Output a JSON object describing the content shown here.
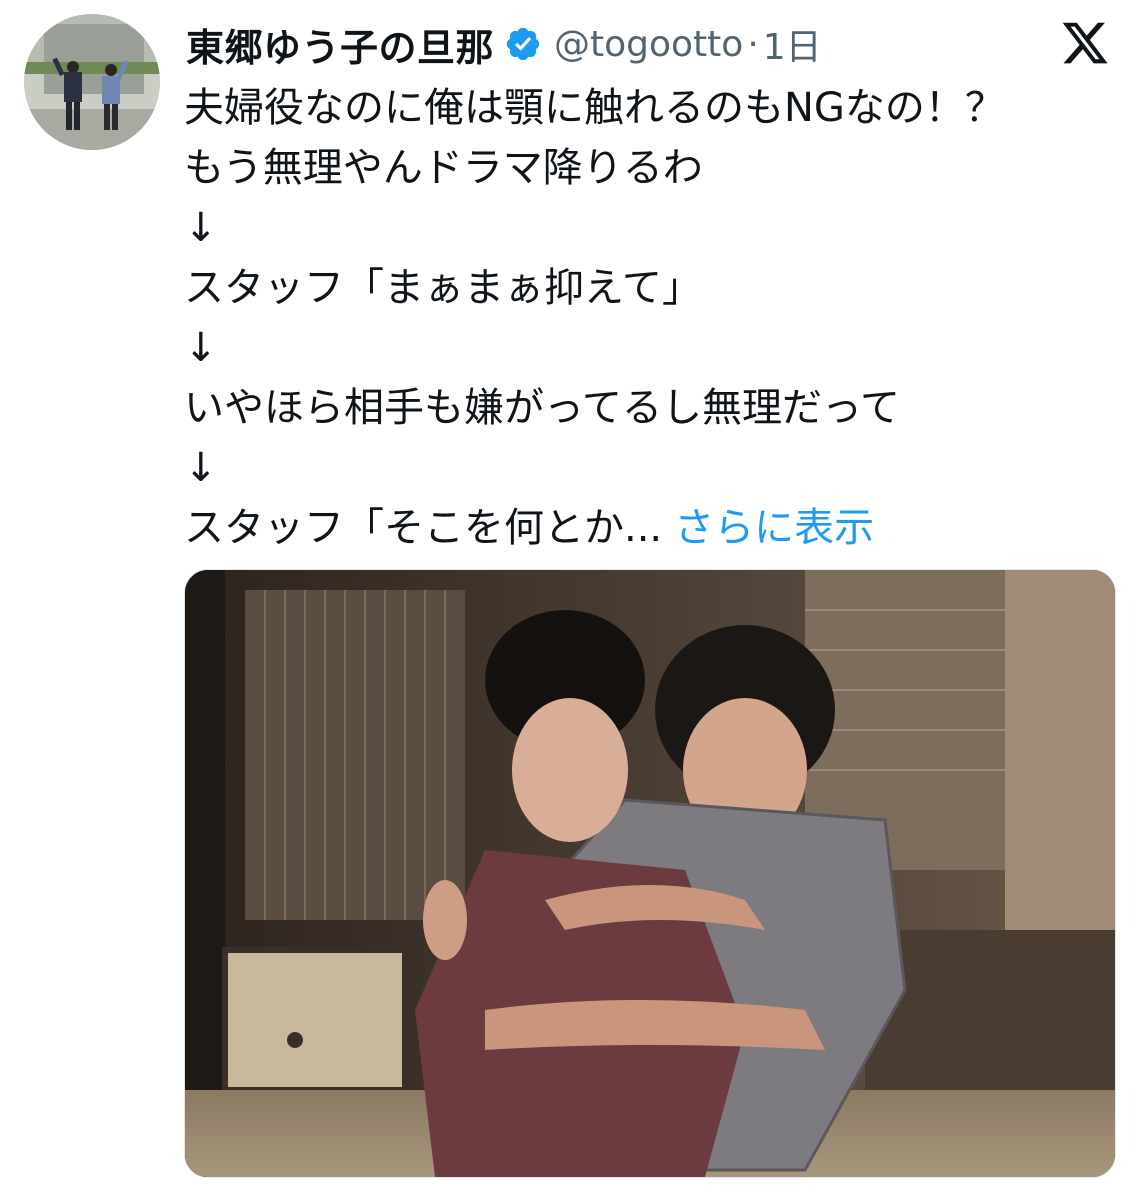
{
  "tweet": {
    "display_name": "東郷ゆう子の旦那",
    "handle": "@togootto",
    "separator": "·",
    "time": "1日",
    "lines": [
      "夫婦役なのに俺は顎に触れるのもNGなの！？",
      "もう無理やんドラマ降りるわ",
      "↓",
      "スタッフ「まぁまぁ抑えて」",
      "↓",
      "いやほら相手も嫌がってるし無理だって",
      "↓",
      "スタッフ「そこを何とか..."
    ],
    "show_more": "さらに表示"
  },
  "icons": {
    "verified": "verified-badge-icon",
    "platform": "x-logo-icon"
  },
  "colors": {
    "text": "#0f1419",
    "secondary": "#536471",
    "link": "#1d9bf0",
    "verified": "#1d9bf0"
  }
}
